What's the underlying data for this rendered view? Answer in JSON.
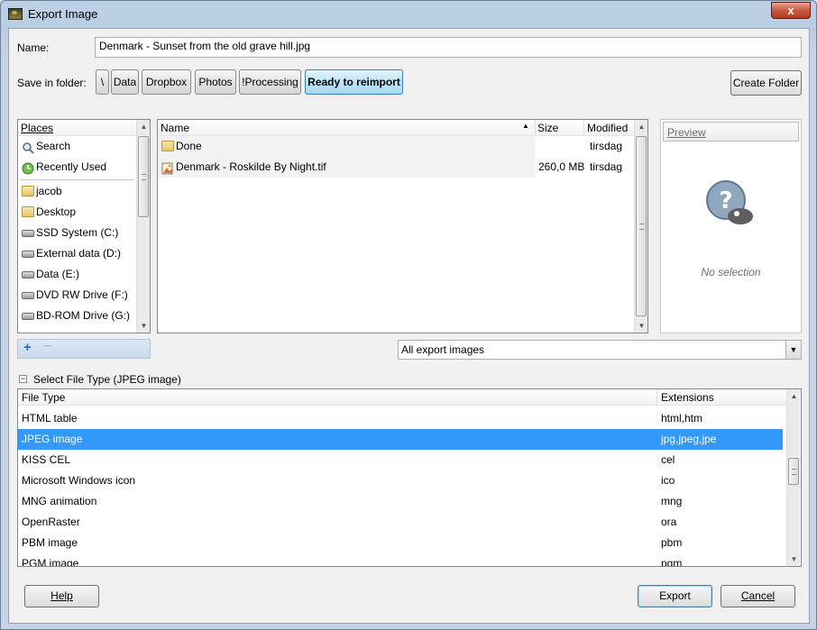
{
  "window": {
    "title": "Export Image",
    "close_symbol": "x"
  },
  "name_field": {
    "label": "Name:",
    "value": "Denmark - Sunset from the old grave hill.jpg"
  },
  "save_in_folder": {
    "label": "Save in folder:",
    "path_buttons": [
      "\\",
      "Data",
      "Dropbox",
      "Photos",
      "!Processing",
      "Ready to reimport"
    ],
    "active_index": 5,
    "create_folder_label": "Create Folder"
  },
  "places": {
    "header": "Places",
    "items": [
      {
        "label": "Search",
        "icon": "search-icon"
      },
      {
        "label": "Recently Used",
        "icon": "recent-icon"
      },
      {
        "label": "jacob",
        "icon": "folder-icon"
      },
      {
        "label": "Desktop",
        "icon": "folder-icon"
      },
      {
        "label": "SSD System (C:)",
        "icon": "drive-icon"
      },
      {
        "label": "External data (D:)",
        "icon": "drive-icon"
      },
      {
        "label": "Data (E:)",
        "icon": "drive-icon"
      },
      {
        "label": "DVD RW Drive (F:)",
        "icon": "optical-drive-icon"
      },
      {
        "label": "BD-ROM Drive (G:)",
        "icon": "optical-drive-icon"
      }
    ],
    "add_symbol": "+",
    "remove_symbol": "—"
  },
  "files": {
    "columns": {
      "name": "Name",
      "size": "Size",
      "modified": "Modified"
    },
    "rows": [
      {
        "name": "Done",
        "size": "",
        "modified": "tirsdag",
        "icon": "folder-icon"
      },
      {
        "name": "Denmark - Roskilde By Night.tif",
        "size": "260,0 MB",
        "modified": "tirsdag",
        "icon": "image-file-icon"
      }
    ]
  },
  "preview": {
    "header": "Preview",
    "status": "No selection",
    "icon": "question-mark-icon"
  },
  "filter": {
    "selected": "All export images"
  },
  "file_type": {
    "toggle_label": "Select File Type (JPEG image)",
    "columns": {
      "type": "File Type",
      "extensions": "Extensions"
    },
    "rows": [
      {
        "type": "HTML table",
        "ext": "html,htm"
      },
      {
        "type": "JPEG image",
        "ext": "jpg,jpeg,jpe"
      },
      {
        "type": "KISS CEL",
        "ext": "cel"
      },
      {
        "type": "Microsoft Windows icon",
        "ext": "ico"
      },
      {
        "type": "MNG animation",
        "ext": "mng"
      },
      {
        "type": "OpenRaster",
        "ext": "ora"
      },
      {
        "type": "PBM image",
        "ext": "pbm"
      },
      {
        "type": "PGM image",
        "ext": "pgm"
      }
    ],
    "selected_index": 1
  },
  "buttons": {
    "help": "Help",
    "export": "Export",
    "cancel": "Cancel"
  },
  "colors": {
    "selection": "#3399ff",
    "active_path": "#bfe4f8",
    "title_bar": "#b9cde3"
  }
}
